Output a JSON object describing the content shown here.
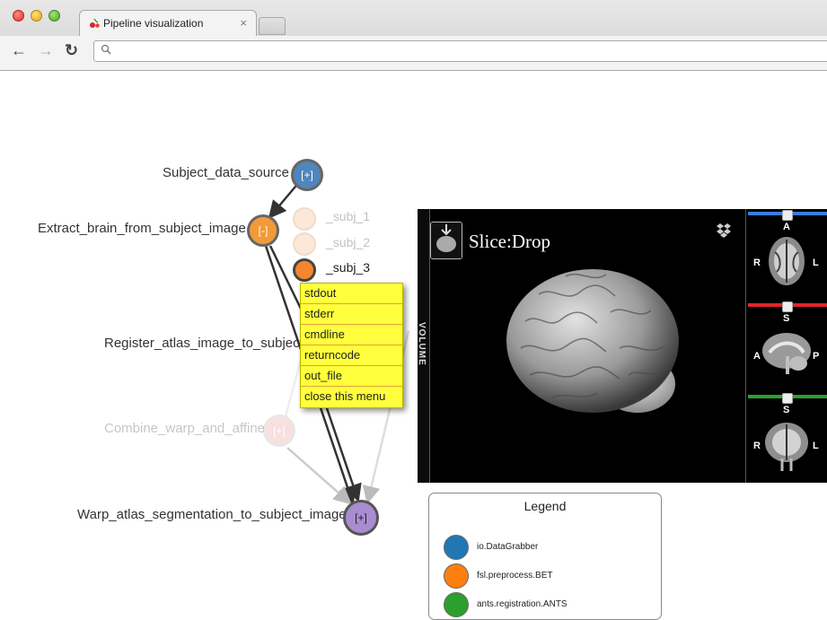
{
  "browser": {
    "tab_title": "Pipeline visualization",
    "tab_close": "×",
    "address_value": ""
  },
  "graph": {
    "nodes": [
      {
        "label": "Subject_data_source",
        "button": "[+]",
        "color": "#4f86bc"
      },
      {
        "label": "Extract_brain_from_subject_image",
        "button": "[-]",
        "color": "#f39a38"
      },
      {
        "label": "Register_atlas_image_to_subject",
        "button": "",
        "color": "#f39a38"
      },
      {
        "label": "Combine_warp_and_affine",
        "button": "[+]",
        "color": "#ee9090"
      },
      {
        "label": "Warp_atlas_segmentation_to_subject_image",
        "button": "[+]",
        "color": "#a98ccf"
      }
    ],
    "subjects": [
      {
        "label": "_subj_1",
        "active": false
      },
      {
        "label": "_subj_2",
        "active": false
      },
      {
        "label": "_subj_3",
        "active": true
      }
    ]
  },
  "context_menu": {
    "items": [
      "stdout",
      "stderr",
      "cmdline",
      "returncode",
      "out_file",
      "close this menu"
    ],
    "bg_color": "#ffff3d"
  },
  "viewer": {
    "app_name": "Slice:Drop",
    "volume_tab": "VOLUME",
    "panels": [
      {
        "top": "A",
        "left": "R",
        "right": "L",
        "bar_color": "#3b7ddb"
      },
      {
        "top": "S",
        "left": "A",
        "right": "P",
        "bar_color": "#e0252a"
      },
      {
        "top": "S",
        "left": "R",
        "right": "L",
        "bar_color": "#2ea02e"
      }
    ]
  },
  "legend": {
    "title": "Legend",
    "items": [
      {
        "label": "io.DataGrabber",
        "color": "#2077b4"
      },
      {
        "label": "fsl.preprocess.BET",
        "color": "#ff7f0e"
      },
      {
        "label": "ants.registration.ANTS",
        "color": "#2ca02c"
      }
    ]
  }
}
